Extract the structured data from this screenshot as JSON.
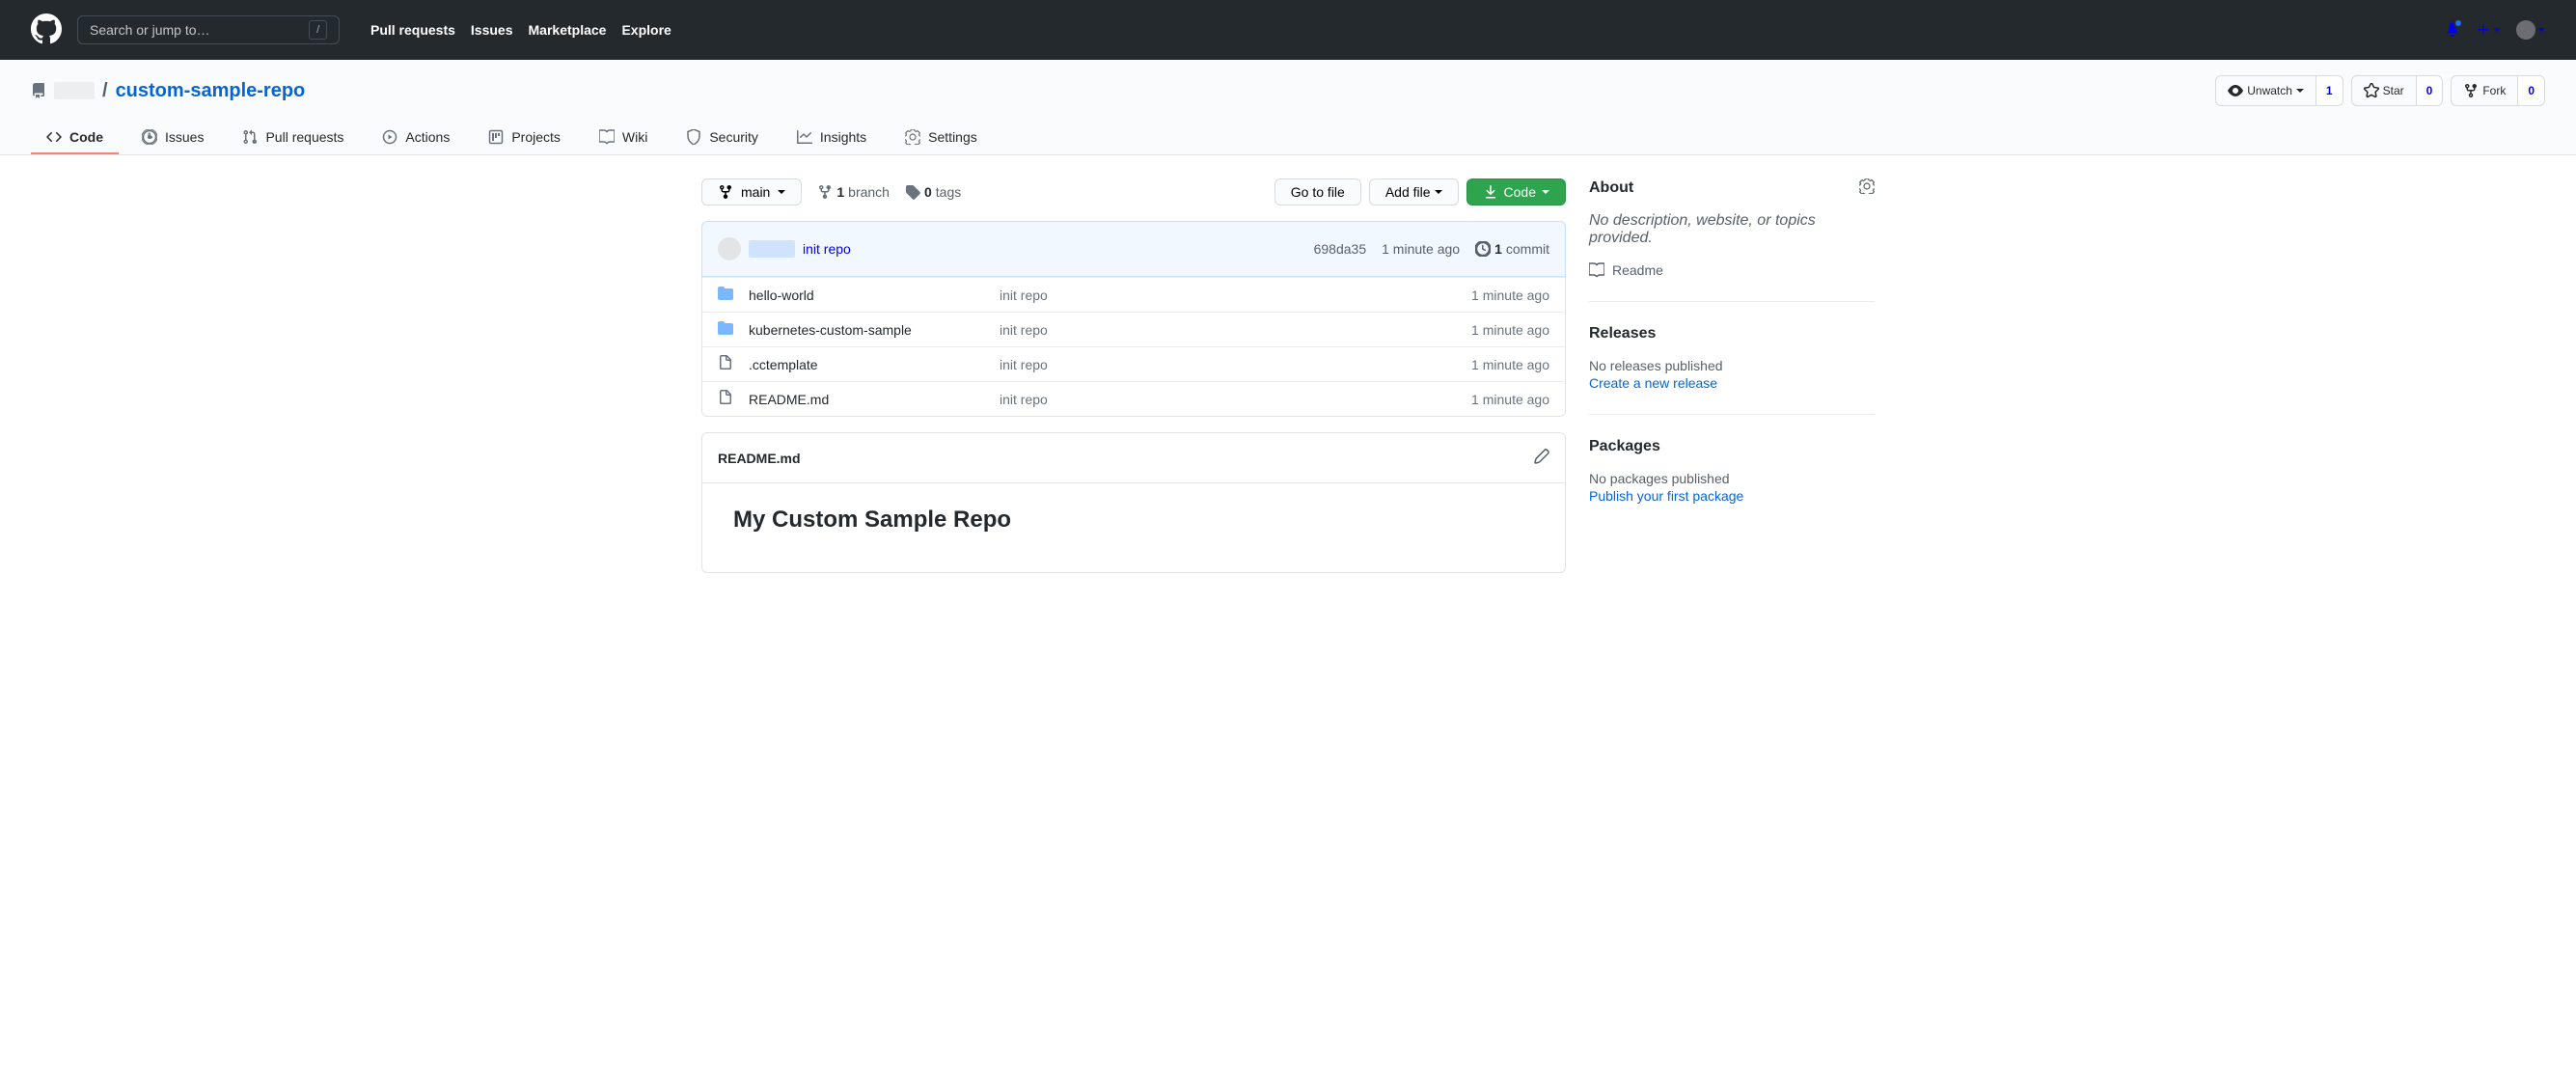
{
  "header": {
    "search_placeholder": "Search or jump to…",
    "nav": [
      "Pull requests",
      "Issues",
      "Marketplace",
      "Explore"
    ]
  },
  "repo": {
    "name": "custom-sample-repo",
    "separator": "/",
    "watch_label": "Unwatch",
    "watch_count": "1",
    "star_label": "Star",
    "star_count": "0",
    "fork_label": "Fork",
    "fork_count": "0"
  },
  "tabs": [
    {
      "label": "Code"
    },
    {
      "label": "Issues"
    },
    {
      "label": "Pull requests"
    },
    {
      "label": "Actions"
    },
    {
      "label": "Projects"
    },
    {
      "label": "Wiki"
    },
    {
      "label": "Security"
    },
    {
      "label": "Insights"
    },
    {
      "label": "Settings"
    }
  ],
  "branch": {
    "current": "main",
    "branch_count": "1",
    "branch_word": "branch",
    "tag_count": "0",
    "tag_word": "tags"
  },
  "filenav": {
    "go_to_file": "Go to file",
    "add_file": "Add file",
    "code": "Code"
  },
  "latest_commit": {
    "message": "init repo",
    "sha": "698da35",
    "age": "1 minute ago",
    "commit_count": "1",
    "commit_word": "commit"
  },
  "files": [
    {
      "type": "dir",
      "name": "hello-world",
      "msg": "init repo",
      "age": "1 minute ago"
    },
    {
      "type": "dir",
      "name": "kubernetes-custom-sample",
      "msg": "init repo",
      "age": "1 minute ago"
    },
    {
      "type": "file",
      "name": ".cctemplate",
      "msg": "init repo",
      "age": "1 minute ago"
    },
    {
      "type": "file",
      "name": "README.md",
      "msg": "init repo",
      "age": "1 minute ago"
    }
  ],
  "readme": {
    "filename": "README.md",
    "heading": "My Custom Sample Repo"
  },
  "about": {
    "title": "About",
    "description": "No description, website, or topics provided.",
    "readme_label": "Readme"
  },
  "releases": {
    "title": "Releases",
    "empty": "No releases published",
    "action": "Create a new release"
  },
  "packages": {
    "title": "Packages",
    "empty": "No packages published",
    "action": "Publish your first package"
  }
}
